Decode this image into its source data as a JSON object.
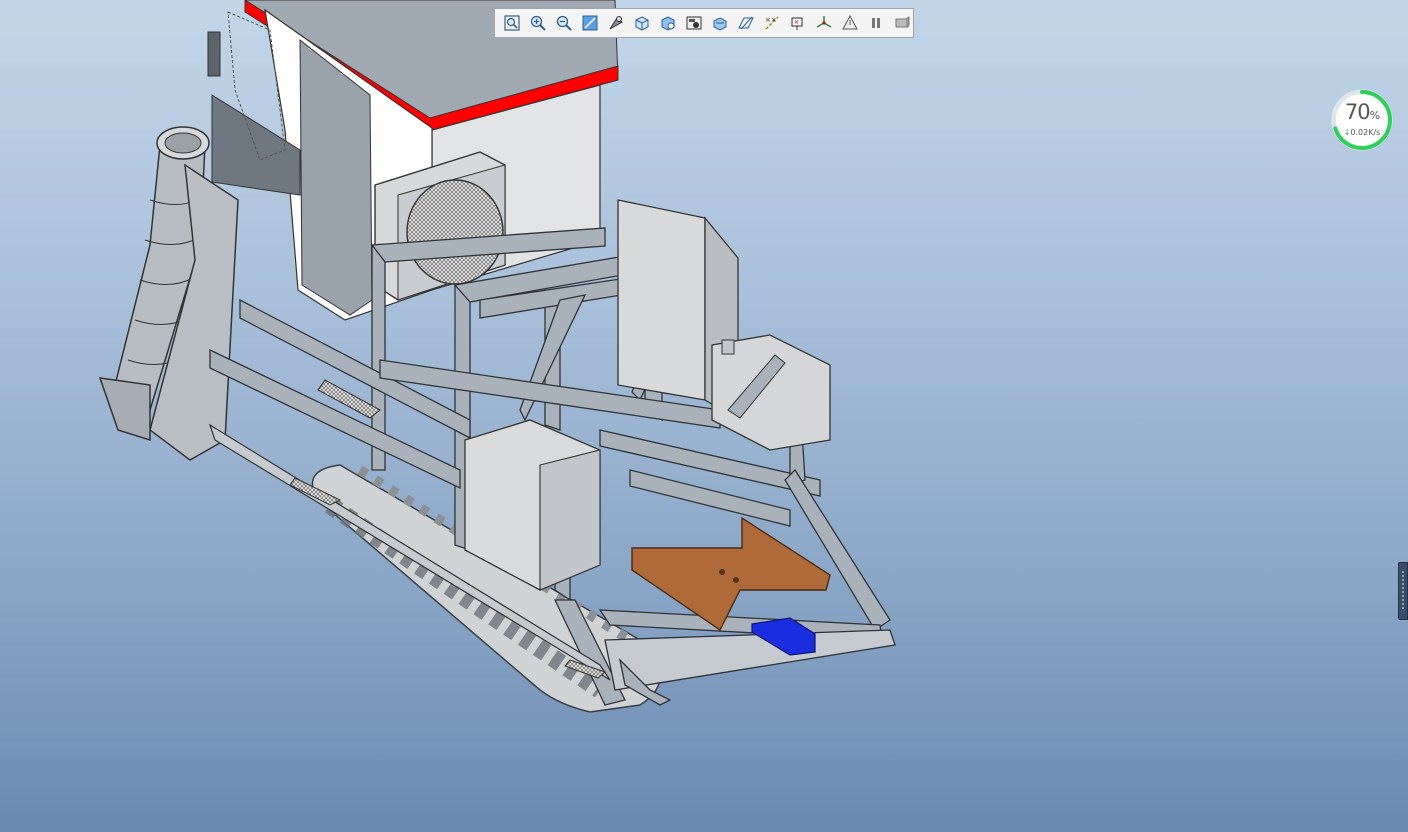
{
  "toolbar": {
    "buttons": [
      {
        "id": "refit",
        "icon": "zoom-fit-icon"
      },
      {
        "id": "zoom-in",
        "icon": "zoom-in-icon"
      },
      {
        "id": "zoom-out",
        "icon": "zoom-out-icon"
      },
      {
        "id": "repaint",
        "icon": "repaint-icon"
      },
      {
        "id": "display-style",
        "icon": "shading-icon"
      },
      {
        "id": "saved-views",
        "icon": "cube-view-icon"
      },
      {
        "id": "view-manager",
        "icon": "view-manager-icon"
      },
      {
        "id": "perspective",
        "icon": "camera-icon"
      },
      {
        "id": "section",
        "icon": "section-icon"
      },
      {
        "id": "datum-planes",
        "icon": "plane-icon"
      },
      {
        "id": "datum-axes",
        "icon": "axis-icon"
      },
      {
        "id": "datum-points",
        "icon": "point-icon"
      },
      {
        "id": "coord-sys",
        "icon": "coordinate-system-icon"
      },
      {
        "id": "annotations",
        "icon": "annotation-icon"
      },
      {
        "id": "pause",
        "icon": "pause-icon"
      },
      {
        "id": "spin",
        "icon": "spin-center-icon"
      }
    ]
  },
  "network_widget": {
    "percent": "70",
    "percent_unit": "%",
    "speed": "0.02K/s",
    "arrow": "↓",
    "ring_color": "#2fcf5a",
    "fill_fraction": 0.7
  },
  "model": {
    "accent_red": "#ff0000",
    "accent_orange": "#b06a3a",
    "accent_blue": "#1a2ee0",
    "body_gray": "#d8dadc",
    "frame_gray": "#9aa4b0"
  }
}
